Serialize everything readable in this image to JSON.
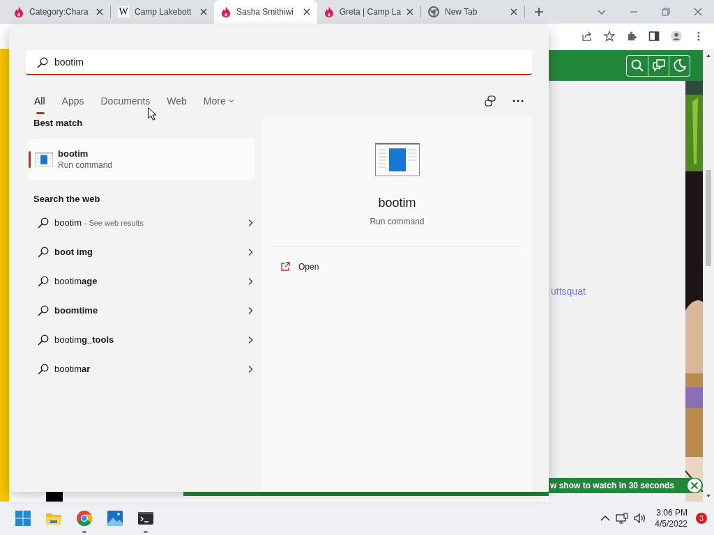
{
  "browser": {
    "tabs": [
      {
        "title": "Category:Chara",
        "kind": "flame",
        "selected": false
      },
      {
        "title": "Camp Lakebott",
        "kind": "letter",
        "letter": "W",
        "selected": false
      },
      {
        "title": "Sasha Smithiwi",
        "kind": "flame",
        "selected": true
      },
      {
        "title": "Greta | Camp La",
        "kind": "flame",
        "selected": false
      },
      {
        "title": "New Tab",
        "kind": "chrome",
        "selected": false
      }
    ]
  },
  "page": {
    "link": "uttsquat",
    "banner": "w show to watch in 30 seconds"
  },
  "search": {
    "query": "bootim",
    "filters": [
      {
        "label": "All",
        "selected": true
      },
      {
        "label": "Apps",
        "selected": false
      },
      {
        "label": "Documents",
        "selected": false
      },
      {
        "label": "Web",
        "selected": false
      },
      {
        "label": "More",
        "kind": "dropdown",
        "selected": false
      }
    ],
    "best_match_heading": "Best match",
    "best_match": {
      "title": "bootim",
      "subtitle": "Run command",
      "selected": true
    },
    "web_heading": "Search the web",
    "web_results": [
      {
        "text": "bootim",
        "hint": "- See web results",
        "bold": false
      },
      {
        "text": "boot img",
        "bold": true
      },
      {
        "text": "bootim**age**",
        "bold": false
      },
      {
        "text": "boomtime",
        "bold": true
      },
      {
        "text": "bootim**g_tools**",
        "bold": false
      },
      {
        "text": "bootim**ar**",
        "bold": false
      }
    ],
    "preview": {
      "title": "bootim",
      "subtitle": "Run command",
      "actions": [
        {
          "label": "Open"
        }
      ]
    }
  },
  "taskbar": {
    "apps": [
      {
        "kind": "start",
        "running": false
      },
      {
        "kind": "folder",
        "running": false
      },
      {
        "kind": "chrome",
        "running": true
      },
      {
        "kind": "photos",
        "running": false
      },
      {
        "kind": "terminal",
        "running": true
      }
    ],
    "time": "3:06 PM",
    "date": "4/5/2022",
    "notifications": "3"
  }
}
